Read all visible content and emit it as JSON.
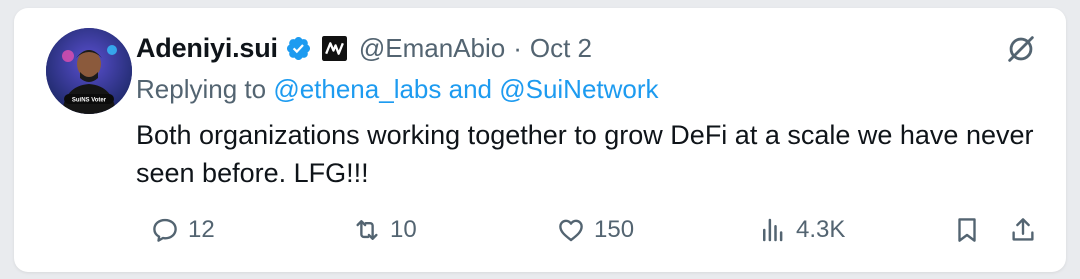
{
  "tweet": {
    "display_name": "Adeniyi.sui",
    "handle": "@EmanAbio",
    "separator": "·",
    "date": "Oct 2",
    "reply_prefix": "Replying to",
    "reply_mentions": "@ethena_labs and @SuiNetwork",
    "text": "Both organizations working together to grow DeFi at a scale we have never seen before. LFG!!!",
    "avatar_badge_text": "SuiNS Voter"
  },
  "actions": {
    "replies": "12",
    "reposts": "10",
    "likes": "150",
    "views": "4.3K"
  },
  "colors": {
    "accent": "#1d9bf0",
    "text": "#0f1419",
    "muted": "#536471"
  }
}
